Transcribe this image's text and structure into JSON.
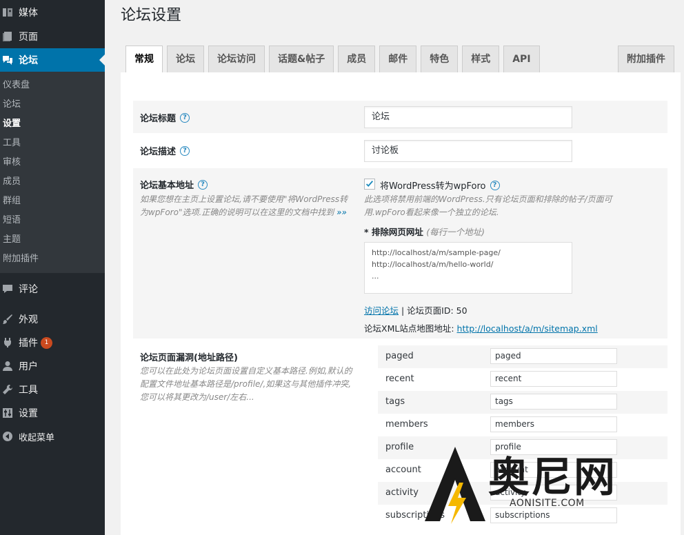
{
  "sidebar": {
    "top_items": [
      {
        "label": "媒体",
        "icon": "media-icon"
      },
      {
        "label": "页面",
        "icon": "page-icon"
      },
      {
        "label": "论坛",
        "icon": "forum-icon"
      }
    ],
    "sub_items": [
      "仪表盘",
      "论坛",
      "设置",
      "工具",
      "审核",
      "成员",
      "群组",
      "短语",
      "主题",
      "附加插件"
    ],
    "current_sub": "设置",
    "bottom_items": [
      {
        "label": "评论",
        "icon": "comment-icon"
      },
      {
        "label": "外观",
        "icon": "appearance-icon"
      },
      {
        "label": "插件",
        "icon": "plugin-icon",
        "badge": "1"
      },
      {
        "label": "用户",
        "icon": "user-icon"
      },
      {
        "label": "工具",
        "icon": "tools-icon"
      },
      {
        "label": "设置",
        "icon": "settings-icon"
      },
      {
        "label": "收起菜单",
        "icon": "collapse-icon"
      }
    ]
  },
  "page": {
    "title": "论坛设置"
  },
  "tabs": [
    "常规",
    "论坛",
    "论坛访问",
    "话题&帖子",
    "成员",
    "邮件",
    "特色",
    "样式",
    "API"
  ],
  "tab_right": "附加插件",
  "active_tab": "常规",
  "settings": {
    "title_label": "论坛标题",
    "title_value": "论坛",
    "desc_label": "论坛描述",
    "desc_value": "讨论板",
    "base_label": "论坛基本地址",
    "base_desc": "如果您想在主页上设置论坛,请不要使用\"将WordPress转为wpForo\"选项.正确的说明可以在这里的文档中找到",
    "base_desc_link": "»»",
    "turn_label": "将WordPress转为wpForo",
    "turn_desc": "此选项将禁用前端的WordPress.只有论坛页面和排除的帖子/页面可用.wpForo看起来像一个独立的论坛.",
    "exclude_label": "* 排除网页网址",
    "exclude_hint": "(每行一个地址)",
    "exclude_value": "http://localhost/a/m/sample-page/\nhttp://localhost/a/m/hello-world/\n...",
    "visit_link": "访问论坛",
    "page_id_text": "| 论坛页面ID: 50",
    "sitemap_label": "论坛XML站点地图地址:",
    "sitemap_link": "http://localhost/a/m/sitemap.xml",
    "slug_label": "论坛页面漏洞(地址路径)",
    "slug_desc": "您可以在此处为论坛页面设置自定义基本路径.例如,默认的配置文件地址基本路径是/profile/,如果这与其他插件冲突,您可以将其更改为/user/左右..."
  },
  "slugs": [
    {
      "key": "paged",
      "value": "paged"
    },
    {
      "key": "recent",
      "value": "recent"
    },
    {
      "key": "tags",
      "value": "tags"
    },
    {
      "key": "members",
      "value": "members"
    },
    {
      "key": "profile",
      "value": "profile"
    },
    {
      "key": "account",
      "value": "account"
    },
    {
      "key": "activity",
      "value": "activity"
    },
    {
      "key": "subscriptions",
      "value": "subscriptions"
    }
  ],
  "watermark": {
    "title": "奥尼网",
    "domain": "AONISITE.COM"
  },
  "colors": {
    "accent": "#0073aa",
    "sidebar": "#23282d",
    "badge": "#ca4a1f",
    "watermark_yellow": "#f5b800"
  }
}
